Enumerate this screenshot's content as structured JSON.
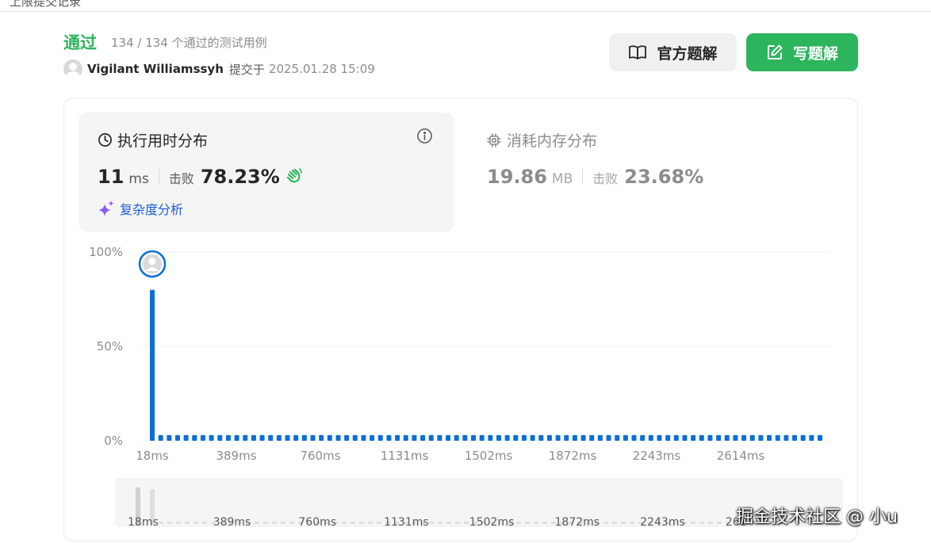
{
  "header": {
    "top_text": "上限提交记录"
  },
  "submission": {
    "status": "通过",
    "passed": "134 / 134 个通过的测试用例",
    "user_name": "Vigilant Williamssyh",
    "submitted_label": "提交于",
    "submitted_time": "2025.01.28 15:09"
  },
  "actions": {
    "official_solution": "官方题解",
    "write_solution": "写题解"
  },
  "runtime": {
    "title": "执行用时分布",
    "value": "11",
    "unit": "ms",
    "beat_label": "击败",
    "beat_value": "78.23%",
    "complexity_link": "复杂度分析"
  },
  "memory": {
    "title": "消耗内存分布",
    "value": "19.86",
    "unit": "MB",
    "beat_label": "击败",
    "beat_value": "23.68%"
  },
  "colors": {
    "success": "#2db55d",
    "bar": "#0a6fd6",
    "link": "#1a5ddb"
  },
  "chart_data": {
    "type": "bar",
    "title": "",
    "xlabel": "",
    "ylabel": "",
    "y_ticks": [
      "100%",
      "50%",
      "0%"
    ],
    "ylim": [
      0,
      100
    ],
    "x_ticks": [
      "18ms",
      "389ms",
      "760ms",
      "1131ms",
      "1502ms",
      "1872ms",
      "2243ms",
      "2614ms"
    ],
    "bin_count": 80,
    "values": [
      80,
      3,
      3,
      3,
      3,
      3,
      3,
      3,
      3,
      3,
      3,
      3,
      3,
      3,
      3,
      3,
      3,
      3,
      3,
      3,
      3,
      3,
      3,
      3,
      3,
      3,
      3,
      3,
      3,
      3,
      3,
      3,
      3,
      3,
      3,
      3,
      3,
      3,
      3,
      3,
      3,
      3,
      3,
      3,
      3,
      3,
      3,
      3,
      3,
      3,
      3,
      3,
      3,
      3,
      3,
      3,
      3,
      3,
      3,
      3,
      3,
      3,
      3,
      3,
      3,
      3,
      3,
      3,
      3,
      3,
      3,
      3,
      3,
      3,
      3,
      3,
      3,
      3,
      3,
      3
    ],
    "marker_bin": 0,
    "grid": true,
    "mini_x_ticks": [
      "18ms",
      "389ms",
      "760ms",
      "1131ms",
      "1502ms",
      "1872ms",
      "2243ms",
      "261"
    ]
  },
  "watermark": "掘金技术社区 @ 小u"
}
